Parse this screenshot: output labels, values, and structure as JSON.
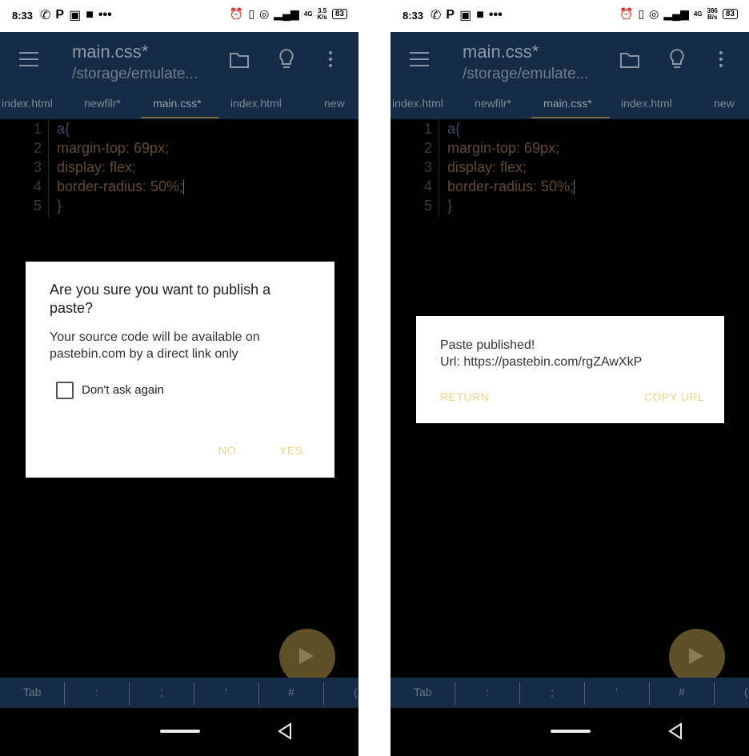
{
  "status": {
    "time": "8:33",
    "left": {
      "speed_top": "3.5",
      "speed_bottom": "K/s"
    },
    "right": {
      "speed_top": "386",
      "speed_bottom": "B/s"
    },
    "battery": "83",
    "network": "4G"
  },
  "app": {
    "title": "main.css*",
    "subtitle": "/storage/emulate...",
    "tabs": [
      "index.html",
      "newfilr*",
      "main.css*",
      "index.html",
      "new"
    ]
  },
  "code": {
    "line_numbers": [
      "1",
      "2",
      "3",
      "4",
      "5"
    ],
    "lines": [
      "a{",
      "margin-top: 69px;",
      "display: flex;",
      "border-radius: 50%;",
      "}"
    ]
  },
  "dialog_confirm": {
    "title": "Are you sure you want to publish a paste?",
    "message": "Your source code will be available on pastebin.com by a direct link only",
    "checkbox_label": "Don't ask again",
    "no": "NO",
    "yes": "YES"
  },
  "dialog_published": {
    "line1": "Paste published!",
    "line2": "Url: https://pastebin.com/rgZAwXkP",
    "return": "RETURN",
    "copy": "COPY URL"
  },
  "keys": [
    "Tab",
    ":",
    ";",
    "'",
    "#",
    "("
  ],
  "colors": {
    "appbar": "#162c46",
    "accent": "#e8d688",
    "fab": "#5e5129"
  }
}
